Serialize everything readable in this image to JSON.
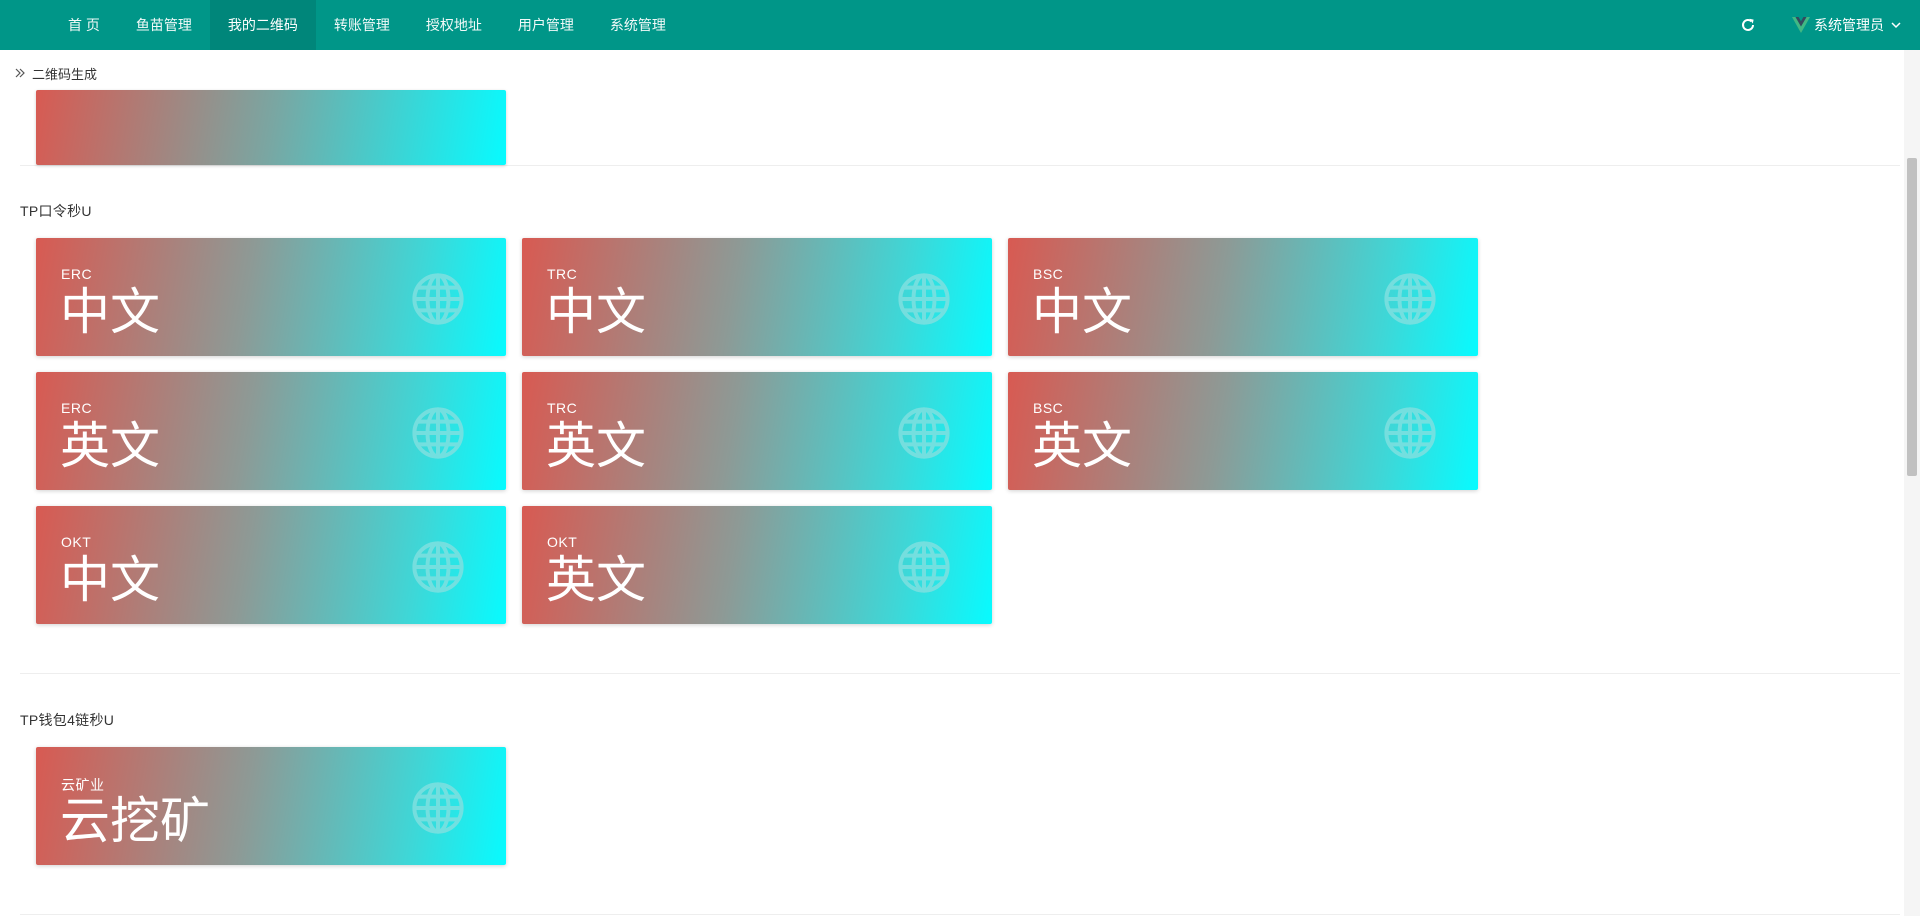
{
  "colors": {
    "accent": "#009688",
    "grad_start": "#d85a52",
    "grad_end": "#07fbff"
  },
  "nav": {
    "items": [
      {
        "label": "首 页",
        "active": false
      },
      {
        "label": "鱼苗管理",
        "active": false
      },
      {
        "label": "我的二维码",
        "active": true
      },
      {
        "label": "转账管理",
        "active": false
      },
      {
        "label": "授权地址",
        "active": false
      },
      {
        "label": "用户管理",
        "active": false
      },
      {
        "label": "系统管理",
        "active": false
      }
    ],
    "user": {
      "name": "系统管理员",
      "icon": "vue-logo-icon"
    },
    "refresh_icon": "refresh-icon"
  },
  "breadcrumb": {
    "label": "二维码生成",
    "icon": "double-chevron-right-icon"
  },
  "sections": [
    {
      "title": "TP口令秒U",
      "cards": [
        {
          "sub": "ERC",
          "main": "中文",
          "icon": "globe-icon"
        },
        {
          "sub": "TRC",
          "main": "中文",
          "icon": "globe-icon"
        },
        {
          "sub": "BSC",
          "main": "中文",
          "icon": "globe-icon"
        },
        {
          "sub": "ERC",
          "main": "英文",
          "icon": "globe-icon"
        },
        {
          "sub": "TRC",
          "main": "英文",
          "icon": "globe-icon"
        },
        {
          "sub": "BSC",
          "main": "英文",
          "icon": "globe-icon"
        },
        {
          "sub": "OKT",
          "main": "中文",
          "icon": "globe-icon"
        },
        {
          "sub": "OKT",
          "main": "英文",
          "icon": "globe-icon"
        }
      ]
    },
    {
      "title": "TP钱包4链秒U",
      "cards": [
        {
          "sub": "云矿业",
          "main": "云挖矿",
          "icon": "globe-icon"
        }
      ]
    }
  ]
}
